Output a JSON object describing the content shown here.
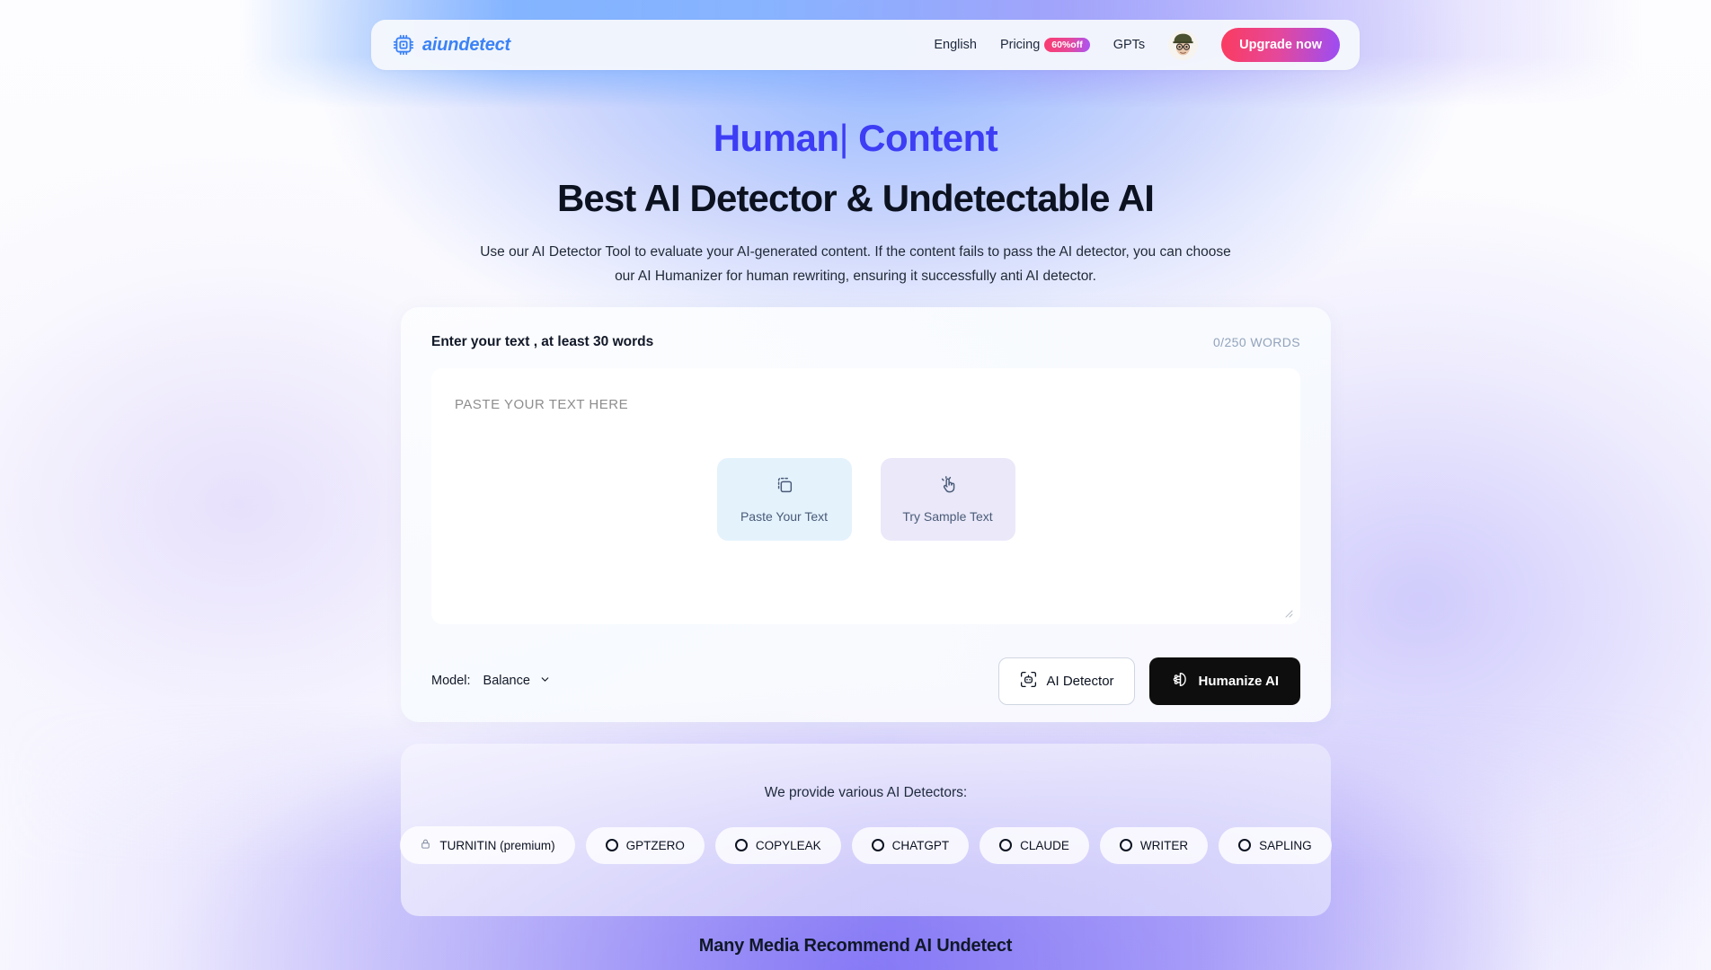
{
  "header": {
    "logo_text": "aiundetect",
    "logo_icon": "cpu-chip-icon",
    "nav": [
      {
        "label": "English",
        "name": "language"
      },
      {
        "label": "Pricing",
        "name": "pricing"
      },
      {
        "label": "GPTs",
        "name": "gpts"
      }
    ],
    "pricing_badge": "60%off",
    "avatar_alt": "user-avatar",
    "upgrade_label": "Upgrade now"
  },
  "hero": {
    "rotating_word": "Human",
    "cursor": "|",
    "rotating_suffix": " Content",
    "title": "Best AI Detector & Undetectable AI",
    "subtitle": "Use our AI Detector Tool to evaluate your AI-generated content. If the content fails to pass the AI detector, you can choose our AI Humanizer for human rewriting, ensuring it successfully anti AI detector."
  },
  "editor_card": {
    "head_title": "Enter your text , at least 30 words",
    "word_count": "0/250 WORDS",
    "placeholder": "PASTE YOUR TEXT HERE",
    "quick_actions": [
      {
        "label": "Paste Your Text",
        "icon": "copy-icon"
      },
      {
        "label": "Try Sample Text",
        "icon": "tap-click-icon"
      }
    ],
    "model_label": "Model:",
    "model_value": "Balance",
    "detector_button": "AI Detector",
    "humanize_button": "Humanize AI"
  },
  "detectors_panel": {
    "title": "We provide various AI Detectors:",
    "pills": [
      {
        "label": "TURNITIN (premium)",
        "icon": "lock-icon"
      },
      {
        "label": "GPTZERO",
        "icon": "circle-icon"
      },
      {
        "label": "COPYLEAK",
        "icon": "circle-icon"
      },
      {
        "label": "CHATGPT",
        "icon": "circle-icon"
      },
      {
        "label": "CLAUDE",
        "icon": "circle-icon"
      },
      {
        "label": "WRITER",
        "icon": "circle-icon"
      },
      {
        "label": "SAPLING",
        "icon": "circle-icon"
      }
    ]
  },
  "media_section": {
    "heading": "Many Media Recommend AI Undetect"
  },
  "colors": {
    "brand_blue": "#3b82f6",
    "hero_accent": "#3d3df5",
    "upgrade_gradient_start": "#fb3b5f",
    "upgrade_gradient_end": "#9b4df5",
    "humanize_bg": "#0e0e0e",
    "paste_action_bg": "#e4f2fc",
    "sample_action_bg": "#eae8f9"
  }
}
